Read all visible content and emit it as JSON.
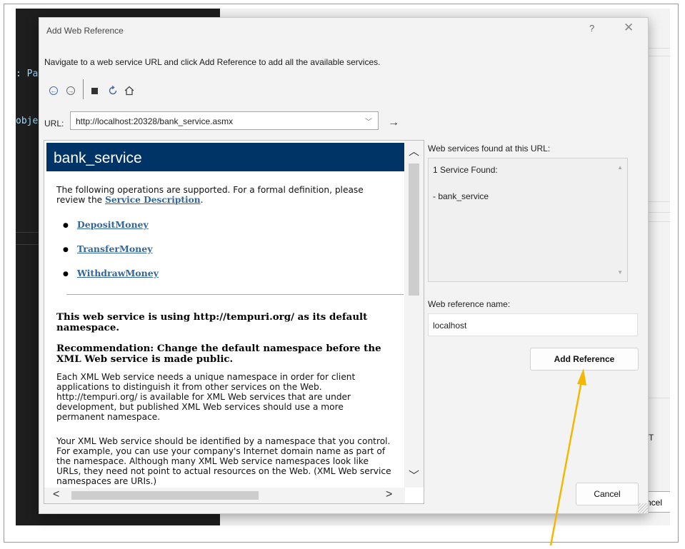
{
  "background": {
    "code_frag1": ": Pa",
    "code_frag2": "obje",
    "right_frag": "T",
    "cancel_frag": "ncel"
  },
  "dialog": {
    "title": "Add Web Reference",
    "help": "?",
    "close": "✕",
    "instructions": "Navigate to a web service URL and click Add Reference to add all the available services.",
    "toolbar_icons": [
      "back-icon",
      "forward-icon",
      "stop-icon",
      "refresh-icon",
      "home-icon"
    ],
    "url_label": "URL:",
    "url_value": "http://localhost:20328/bank_service.asmx",
    "go_glyph": "→"
  },
  "browser": {
    "service_name": "bank_service",
    "intro_pre": "The following operations are supported. For a formal definition, please review the ",
    "intro_link": "Service Description",
    "intro_post": ".",
    "operations": [
      "DepositMoney",
      "TransferMoney",
      "WithdrawMoney"
    ],
    "heading1": "This web service is using http://tempuri.org/ as its default namespace.",
    "heading2": "Recommendation: Change the default namespace before the XML Web service is made public.",
    "para1": "Each XML Web service needs a unique namespace in order for client applications to distinguish it from other services on the Web. http://tempuri.org/ is available for XML Web services that are under development, but published XML Web services should use a more permanent namespace.",
    "para2": "Your XML Web service should be identified by a namespace that you control. For example, you can use your company's Internet domain name as part of the namespace. Although many XML Web service namespaces look like URLs, they need not point to actual resources on the Web. (XML Web service namespaces are URIs.)"
  },
  "panel": {
    "found_label": "Web services found at this URL:",
    "found_line1": "1 Service Found:",
    "found_line2": "- bank_service",
    "ref_label": "Web reference name:",
    "ref_value": "localhost",
    "add_button": "Add Reference",
    "cancel_button": "Cancel"
  },
  "annotation": {
    "arrow_color": "#f5b800"
  }
}
